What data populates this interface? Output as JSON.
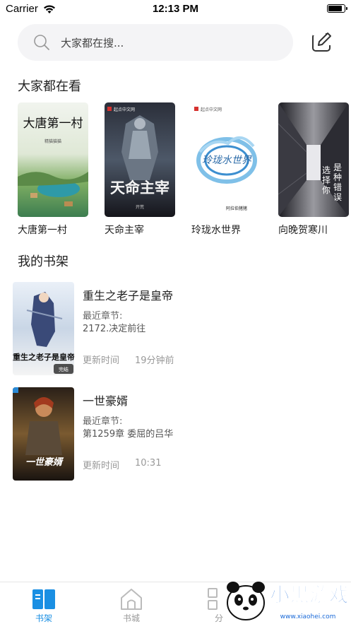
{
  "status_bar": {
    "carrier": "Carrier",
    "time": "12:13 PM",
    "battery_level": 0.9
  },
  "search": {
    "placeholder": "大家都在搜..."
  },
  "popular": {
    "title": "大家都在看",
    "books": [
      {
        "name": "大唐第一村",
        "cover_title": "大唐第一村",
        "cover_author": "精猫猫猫",
        "colors": [
          "#e8efe4",
          "#6a9a55",
          "#2e8a9a"
        ]
      },
      {
        "name": "天命主宰",
        "cover_title": "天命主宰",
        "cover_author": "开荒",
        "cover_brand": "起点中文网",
        "colors": [
          "#1a1a22",
          "#4a5a6a",
          "#c8c8c8"
        ]
      },
      {
        "name": "玲珑水世界",
        "cover_title": "玲珑水世界",
        "cover_author": "阿拉伯猪猪",
        "cover_brand": "起点中文网",
        "colors": [
          "#ffffff",
          "#4aa0d8",
          "#2a6aa8"
        ]
      },
      {
        "name": "向晚贺寒川",
        "cover_title": "选择你是种错误",
        "colors": [
          "#2a2a30",
          "#8a8a90",
          "#e0e0e0"
        ]
      }
    ]
  },
  "shelf": {
    "title": "我的书架",
    "items": [
      {
        "title": "重生之老子是皇帝",
        "latest_label": "最近章节:",
        "latest_chapter": "2172.决定前往",
        "update_label": "更新时间",
        "update_time": "19分钟前",
        "cover_title": "重生之老子是皇帝",
        "cover_badge": "完结"
      },
      {
        "title": "一世豪婿",
        "latest_label": "最近章节:",
        "latest_chapter": "第1259章 委屈的吕华",
        "update_label": "更新时间",
        "update_time": "10:31",
        "cover_title": "一世豪婿"
      }
    ]
  },
  "tabs": [
    {
      "label": "书架",
      "icon": "bookshelf-icon",
      "active": true
    },
    {
      "label": "书城",
      "icon": "home-icon",
      "active": false
    },
    {
      "label": "分",
      "icon": "category-icon",
      "active": false
    }
  ],
  "watermark": {
    "text": "小黑游戏",
    "url_text": "www.xiaohei.com"
  },
  "colors": {
    "accent": "#1a8fe3",
    "inactive": "#aaaaaa",
    "search_bg": "#f4f4f6"
  }
}
